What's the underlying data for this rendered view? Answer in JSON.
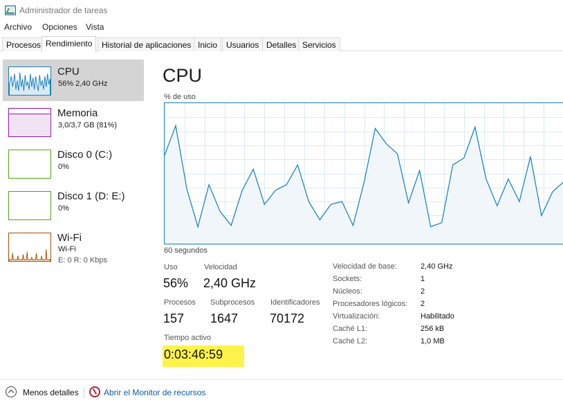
{
  "window": {
    "title": "Administrador de tareas"
  },
  "menu": [
    "Archivo",
    "Opciones",
    "Vista"
  ],
  "tabs": [
    "Procesos",
    "Rendimiento",
    "Historial de aplicaciones",
    "Inicio",
    "Usuarios",
    "Detalles",
    "Servicios"
  ],
  "active_tab": "Rendimiento",
  "sidebar": [
    {
      "title": "CPU",
      "sub1": "56%  2,40 GHz",
      "color": "#117dbb"
    },
    {
      "title": "Memoria",
      "sub1": "3,0/3,7 GB (81%)",
      "color": "#8b12ae"
    },
    {
      "title": "Disco 0 (C:)",
      "sub1": "0%",
      "color": "#4da60c"
    },
    {
      "title": "Disco 1 (D: E:)",
      "sub1": "0%",
      "color": "#4da60c"
    },
    {
      "title": "Wi-Fi",
      "sub1": "Wi-Fi",
      "sub2": "E: 0  R: 0 Kbps",
      "color": "#a74f01"
    }
  ],
  "main": {
    "title": "CPU",
    "chart_label": "% de uso",
    "chart_xlabel": "60 segundos",
    "stats": {
      "uso_label": "Uso",
      "uso": "56%",
      "velocidad_label": "Velocidad",
      "velocidad": "2,40 GHz",
      "procesos_label": "Procesos",
      "procesos": "157",
      "subprocesos_label": "Subprocesos",
      "subprocesos": "1647",
      "identificadores_label": "Identificadores",
      "identificadores": "70172",
      "tiempo_label": "Tiempo activo",
      "tiempo": "0:03:46:59"
    },
    "specs": [
      {
        "key": "Velocidad de base:",
        "value": "2,40 GHz"
      },
      {
        "key": "Sockets:",
        "value": "1"
      },
      {
        "key": "Núcleos:",
        "value": "2"
      },
      {
        "key": "Procesadores lógicos:",
        "value": "2"
      },
      {
        "key": "Virtualización:",
        "value": "Habilitado"
      },
      {
        "key": "Caché L1:",
        "value": "256 kB"
      },
      {
        "key": "Caché L2:",
        "value": "1,0 MB"
      }
    ]
  },
  "footer": {
    "less_details": "Menos detalles",
    "resource_monitor": "Abrir el Monitor de recursos"
  },
  "chart_data": {
    "type": "area",
    "ylabel": "% de uso",
    "xlabel": "60 segundos",
    "ylim": [
      0,
      100
    ],
    "values": [
      63,
      84,
      39,
      12,
      42,
      23,
      13,
      38,
      53,
      28,
      38,
      42,
      56,
      30,
      17,
      28,
      30,
      13,
      44,
      82,
      71,
      64,
      29,
      52,
      12,
      15,
      56,
      61,
      83,
      46,
      27,
      46,
      30,
      62,
      20,
      37,
      44
    ]
  }
}
